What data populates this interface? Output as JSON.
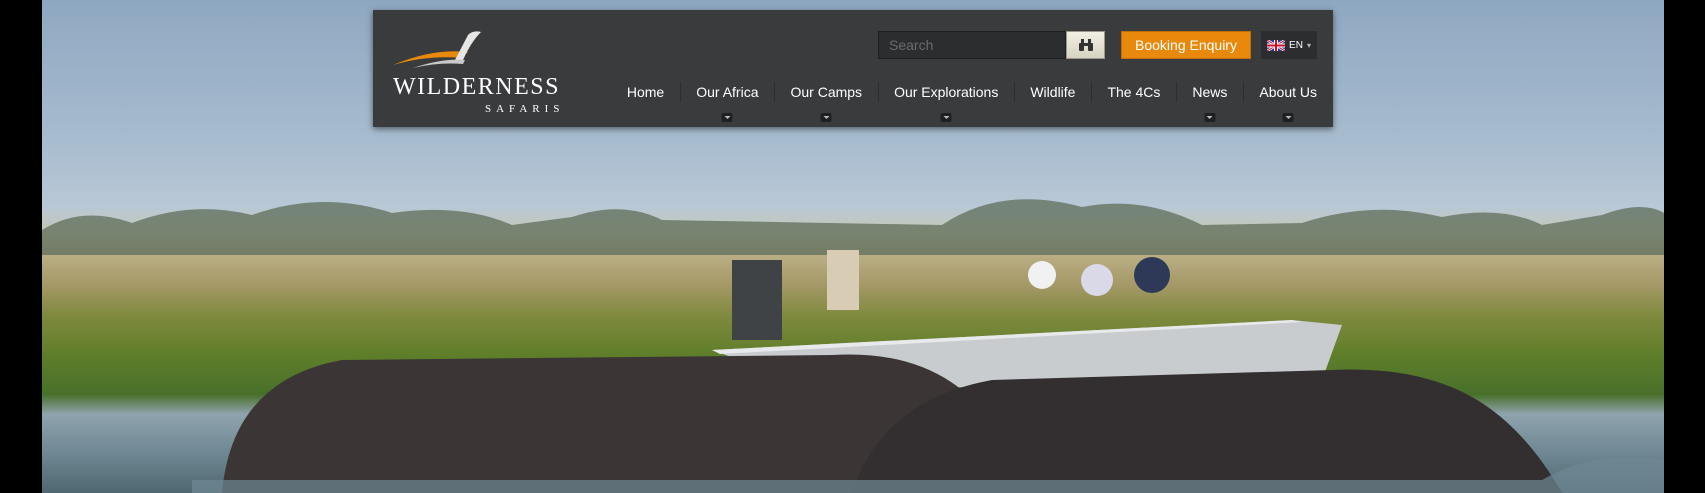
{
  "brand": {
    "name": "WILDERNESS",
    "tagline": "SAFARIS",
    "accent": "#e8890c"
  },
  "search": {
    "placeholder": "Search",
    "button_icon": "binoculars-icon"
  },
  "booking": {
    "label": "Booking Enquiry"
  },
  "language": {
    "code": "EN",
    "flag": "uk-flag-icon"
  },
  "nav": {
    "items": [
      {
        "label": "Home",
        "dropdown": false
      },
      {
        "label": "Our Africa",
        "dropdown": true
      },
      {
        "label": "Our Camps",
        "dropdown": true
      },
      {
        "label": "Our Explorations",
        "dropdown": true
      },
      {
        "label": "Wildlife",
        "dropdown": false
      },
      {
        "label": "The 4Cs",
        "dropdown": false
      },
      {
        "label": "News",
        "dropdown": true
      },
      {
        "label": "About Us",
        "dropdown": true
      }
    ]
  }
}
